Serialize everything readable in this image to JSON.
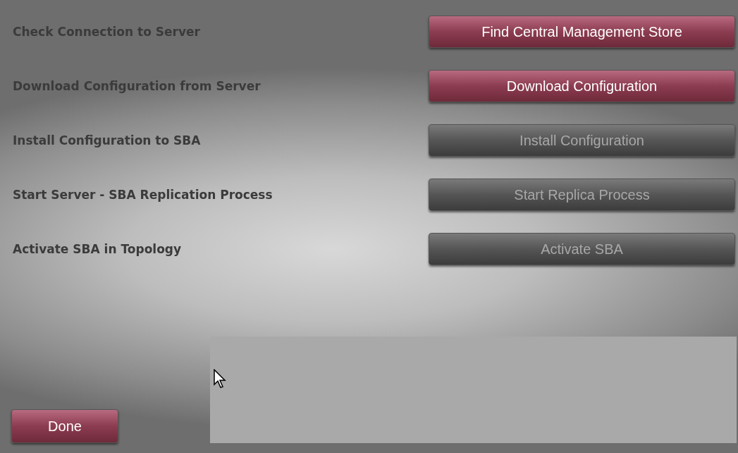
{
  "steps": [
    {
      "label": "Check Connection to Server",
      "button": "Find Central Management Store",
      "disabled": false
    },
    {
      "label": "Download Configuration from Server",
      "button": "Download Configuration",
      "disabled": false
    },
    {
      "label": "Install Configuration to SBA",
      "button": "Install Configuration",
      "disabled": true
    },
    {
      "label": "Start Server - SBA Replication Process",
      "button": "Start Replica Process",
      "disabled": true
    },
    {
      "label": "Activate SBA in Topology",
      "button": "Activate SBA",
      "disabled": true
    }
  ],
  "done_button": "Done"
}
